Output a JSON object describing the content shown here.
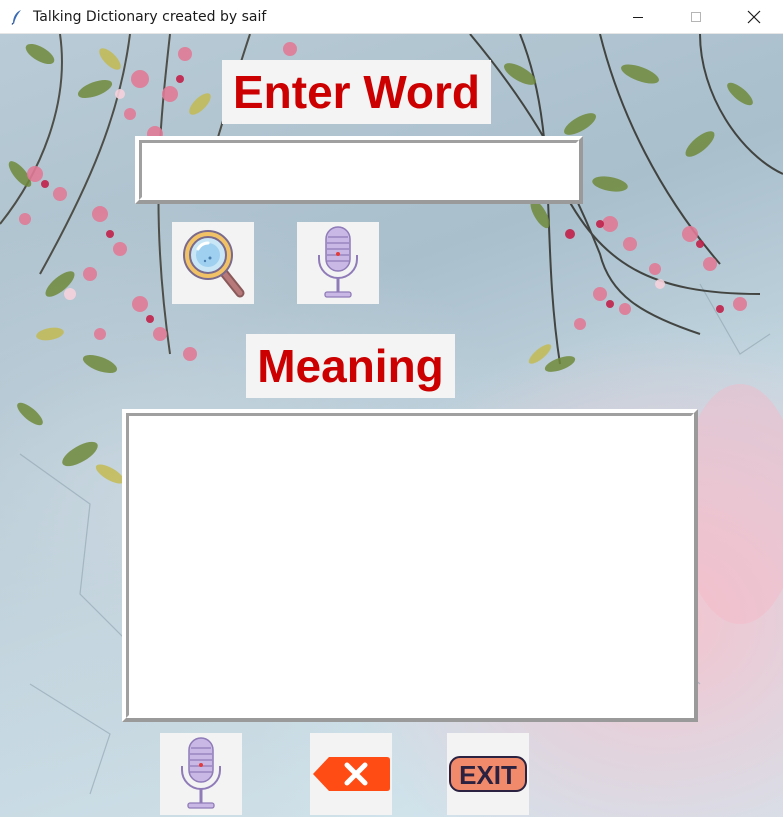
{
  "window": {
    "title": "Talking Dictionary created by saif",
    "app_icon": "feather-icon",
    "controls": [
      "minimize-icon",
      "maximize-icon",
      "close-icon"
    ]
  },
  "labels": {
    "enter_word": "Enter Word",
    "meaning": "Meaning"
  },
  "word_entry": {
    "value": ""
  },
  "meaning_text": {
    "value": ""
  },
  "buttons": {
    "search": {
      "icon": "magnifier-icon"
    },
    "voice_input": {
      "icon": "microphone-icon"
    },
    "speak_meaning": {
      "icon": "microphone-icon"
    },
    "clear": {
      "icon": "backspace-x-icon"
    },
    "exit": {
      "icon": "exit-sign-icon",
      "label": "EXIT"
    }
  },
  "colors": {
    "label_text": "#cc0000",
    "label_bg": "#f4f4f4",
    "clear_red": "#ff4b14",
    "exit_orange": "#f08a6a",
    "mic_purple": "#c9b8e6"
  }
}
